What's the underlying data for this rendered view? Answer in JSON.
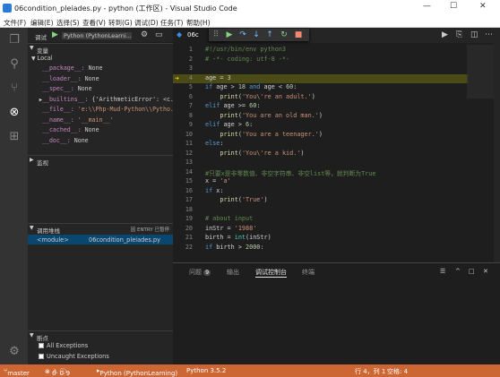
{
  "window": {
    "title": "06condition_pleiades.py - python (工作区) - Visual Studio Code",
    "min": "—",
    "max": "☐",
    "close": "✕"
  },
  "menu": [
    "文件(F)",
    "编辑(E)",
    "选择(S)",
    "查看(V)",
    "转到(G)",
    "调试(D)",
    "任务(T)",
    "帮助(H)"
  ],
  "debug": {
    "label": "调试",
    "config": "Python (PythonLearni..."
  },
  "variables": {
    "header": "变量",
    "local": "Local",
    "items": [
      {
        "name": "__package__:",
        "value": "None",
        "exp": false
      },
      {
        "name": "__loader__:",
        "value": "None",
        "exp": false
      },
      {
        "name": "__spec__:",
        "value": "None",
        "exp": false
      },
      {
        "name": "__builtins__:",
        "value": "{'ArithmeticError': <c...",
        "exp": true
      },
      {
        "name": "__file__:",
        "value": "'e:\\\\Php-Mud-Python\\\\Pytho...",
        "exp": false
      },
      {
        "name": "__name__:",
        "value": "'__main__'",
        "exp": false
      },
      {
        "name": "__cached__:",
        "value": "None",
        "exp": false
      },
      {
        "name": "__doc__:",
        "value": "None",
        "exp": false
      }
    ]
  },
  "watch": {
    "header": "监视"
  },
  "callstack": {
    "header": "调用堆栈",
    "status": "因 ENTRY 已暂停",
    "frame": "<module>",
    "file": "06condition_pleiades.py"
  },
  "breakpoints": {
    "header": "断点",
    "items": [
      "All Exceptions",
      "Uncaught Exceptions"
    ]
  },
  "editor": {
    "tab": "06c",
    "lines": [
      {
        "n": "1",
        "t": "#!/usr/bin/env python3"
      },
      {
        "n": "2",
        "t": "# -*- coding: utf-8 -*-"
      },
      {
        "n": "3",
        "t": ""
      },
      {
        "n": "4",
        "t": "age = 3"
      },
      {
        "n": "5",
        "t": "if age > 18 and age < 60:"
      },
      {
        "n": "6",
        "t": "    print('You\\'re an adult.')"
      },
      {
        "n": "7",
        "t": "elif age >= 60:"
      },
      {
        "n": "8",
        "t": "    print('You are an old man.')"
      },
      {
        "n": "9",
        "t": "elif age > 6:"
      },
      {
        "n": "10",
        "t": "    print('You are a teenager.')"
      },
      {
        "n": "11",
        "t": "else:"
      },
      {
        "n": "12",
        "t": "    print('You\\'re a kid.')"
      },
      {
        "n": "13",
        "t": ""
      },
      {
        "n": "14",
        "t": "#只要x是非零数值、非空字符串、非空list等，就判断为True"
      },
      {
        "n": "15",
        "t": "x = 'a'"
      },
      {
        "n": "16",
        "t": "if x:"
      },
      {
        "n": "17",
        "t": "    print('True')"
      },
      {
        "n": "18",
        "t": ""
      },
      {
        "n": "19",
        "t": "# about input"
      },
      {
        "n": "20",
        "t": "inStr = '1988'"
      },
      {
        "n": "21",
        "t": "birth = int(inStr)"
      },
      {
        "n": "22",
        "t": "if birth > 2000:"
      }
    ]
  },
  "panel": {
    "tabs": [
      "问题",
      "输出",
      "调试控制台",
      "终端"
    ],
    "problems_count": "9"
  },
  "status": {
    "branch": "master",
    "errors": "0",
    "warnings": "0",
    "info": "9",
    "interpreter": "Python (PythonLearning)",
    "python": "Python 3.5.2",
    "position": "行 4，列 1",
    "spaces": "空格: 4"
  },
  "colors": {
    "status": "#cc6633",
    "highlight": "#4b4b18",
    "accent": "#007acc"
  }
}
